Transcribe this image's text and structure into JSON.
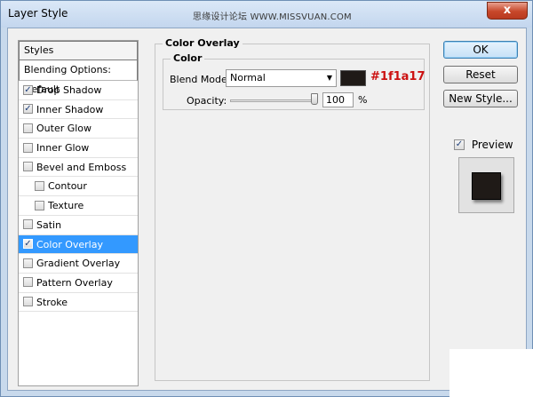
{
  "window": {
    "title": "Layer Style",
    "watermark": "思缘设计论坛 WWW.MISSVUAN.COM",
    "close_label": "x"
  },
  "styles_list": {
    "header": "Styles",
    "blending_options": "Blending Options: Default",
    "items": [
      {
        "label": "Drop Shadow",
        "checked": true
      },
      {
        "label": "Inner Shadow",
        "checked": true
      },
      {
        "label": "Outer Glow",
        "checked": false
      },
      {
        "label": "Inner Glow",
        "checked": false
      },
      {
        "label": "Bevel and Emboss",
        "checked": false
      },
      {
        "label": "Contour",
        "checked": false,
        "sub": true
      },
      {
        "label": "Texture",
        "checked": false,
        "sub": true
      },
      {
        "label": "Satin",
        "checked": false
      },
      {
        "label": "Color Overlay",
        "checked": true,
        "selected": true
      },
      {
        "label": "Gradient Overlay",
        "checked": false
      },
      {
        "label": "Pattern Overlay",
        "checked": false
      },
      {
        "label": "Stroke",
        "checked": false
      }
    ]
  },
  "panel": {
    "title": "Color Overlay",
    "color_group": "Color",
    "blend_mode_label": "Blend Mode:",
    "blend_mode_value": "Normal",
    "swatch_color": "#1f1a17",
    "hex_annotation": "#1f1a17",
    "opacity_label": "Opacity:",
    "opacity_value": "100",
    "opacity_unit": "%",
    "opacity_fraction": 1.0
  },
  "buttons": {
    "ok": "OK",
    "reset": "Reset",
    "new_style": "New Style...",
    "preview_label": "Preview",
    "preview_checked": true
  }
}
